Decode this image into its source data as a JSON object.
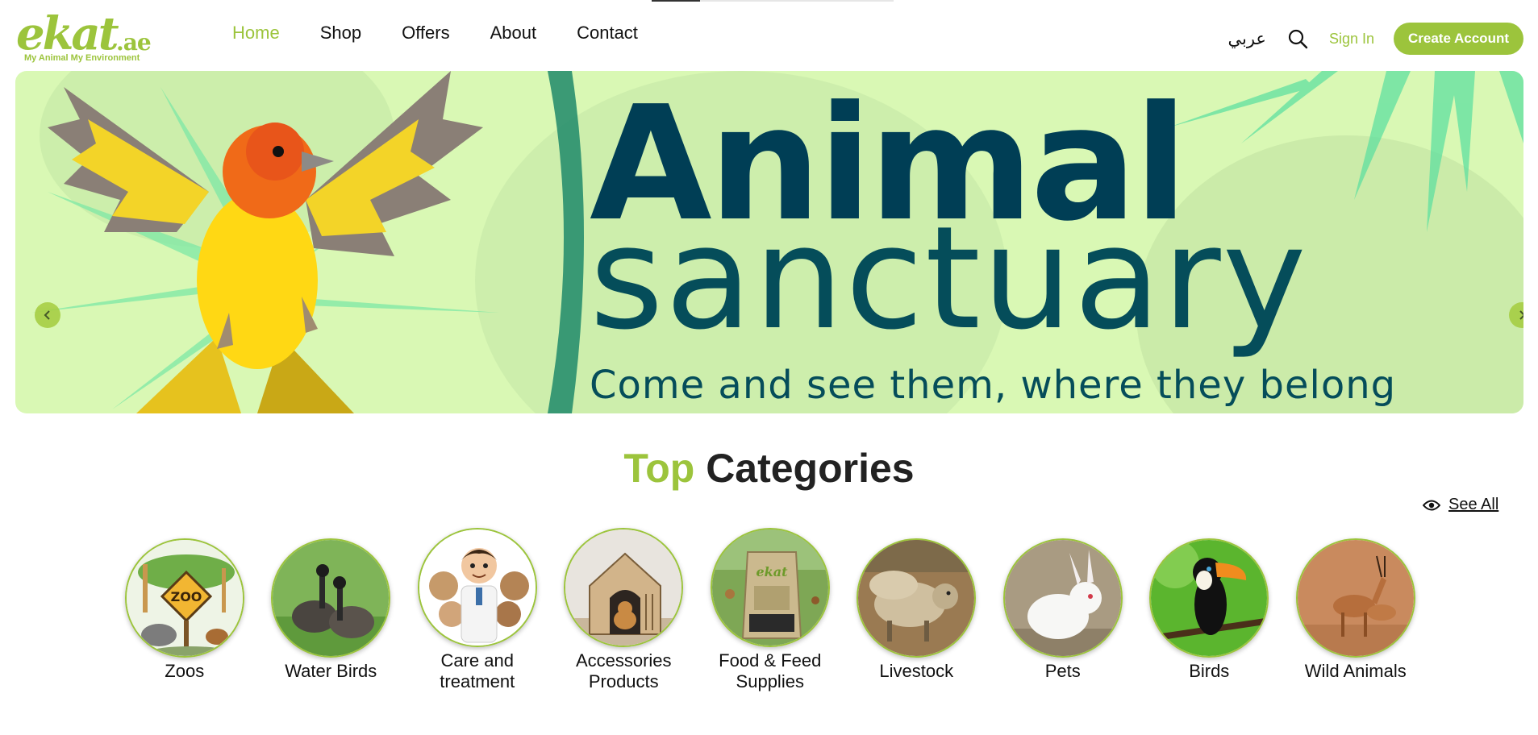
{
  "logo": {
    "word": "ekat",
    "suffix": ".ae",
    "tagline": "My Animal My Environment"
  },
  "nav": {
    "items": [
      {
        "label": "Home",
        "active": true
      },
      {
        "label": "Shop",
        "active": false
      },
      {
        "label": "Offers",
        "active": false
      },
      {
        "label": "About",
        "active": false
      },
      {
        "label": "Contact",
        "active": false
      }
    ]
  },
  "header": {
    "language_label": "عربي",
    "search_icon": "search-icon",
    "signin_label": "Sign In",
    "create_account_label": "Create Account"
  },
  "banner": {
    "title_line1": "Animal",
    "title_line2": "sanctuary",
    "subtitle": "Come and see them, where they belong",
    "prev_icon": "chevron-left-icon",
    "next_icon": "chevron-right-icon"
  },
  "categories": {
    "title_highlight": "Top",
    "title_rest": "Categories",
    "see_all_label": "See All",
    "see_all_icon": "eye-icon",
    "items": [
      {
        "label": "Zoos"
      },
      {
        "label": "Water Birds"
      },
      {
        "label": "Care and treatment"
      },
      {
        "label": "Accessories Products"
      },
      {
        "label": "Food & Feed Supplies"
      },
      {
        "label": "Livestock"
      },
      {
        "label": "Pets"
      },
      {
        "label": "Birds"
      },
      {
        "label": "Wild Animals"
      }
    ]
  },
  "colors": {
    "brand_green": "#9cc43c",
    "banner_bg": "#d9f8b4",
    "banner_title": "#003e55"
  }
}
